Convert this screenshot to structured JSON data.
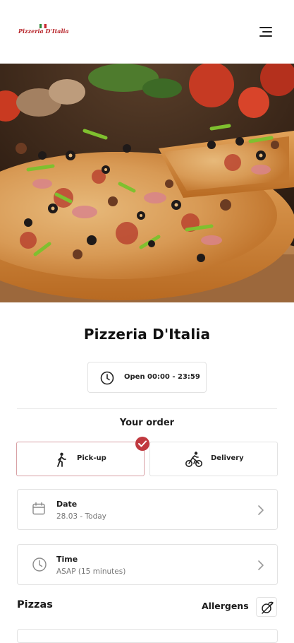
{
  "header": {
    "logo_text": "Pizzeria D'Italia",
    "menu_icon": "hamburger-menu-icon"
  },
  "hero": {
    "alt": "pizza-photo"
  },
  "restaurant": {
    "name": "Pizzeria D'Italia",
    "hours": "Open 00:00 - 23:59",
    "hours_icon": "clock-icon"
  },
  "order": {
    "title": "Your order",
    "options": [
      {
        "label": "Pick-up",
        "icon": "walking-person-icon",
        "selected": true
      },
      {
        "label": "Delivery",
        "icon": "cyclist-icon",
        "selected": false
      }
    ],
    "selected_badge_icon": "checkmark-icon",
    "accent_color": "#c0393f"
  },
  "date": {
    "label": "Date",
    "value": "28.03 - Today",
    "icon": "calendar-icon"
  },
  "time": {
    "label": "Time",
    "value": "ASAP (15 minutes)",
    "icon": "clock-icon"
  },
  "menu_section": {
    "title": "Pizzas",
    "allergens_label": "Allergens",
    "allergens_icon": "allergen-filter-icon"
  }
}
